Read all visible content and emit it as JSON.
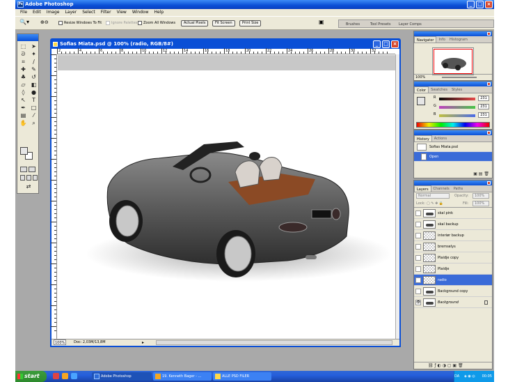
{
  "app": {
    "title": "Adobe Photoshop",
    "menu": [
      "File",
      "Edit",
      "Image",
      "Layer",
      "Select",
      "Filter",
      "View",
      "Window",
      "Help"
    ]
  },
  "options": {
    "resize_windows": "Resize Windows To Fit",
    "ignore_palettes": "Ignore Palettes",
    "zoom_all": "Zoom All Windows",
    "actual_pixels": "Actual Pixels",
    "fit_screen": "Fit Screen",
    "print_size": "Print Size",
    "well_tabs": [
      "Brushes",
      "Tool Presets",
      "Layer Comps"
    ]
  },
  "document": {
    "title": "Sofias Miata.psd @ 100% (radio, RGB/8#)",
    "zoom": "100%",
    "doc_size": "Doc: 2,03M/13,8M",
    "ruler_labels": [
      "2",
      "4",
      "6",
      "8",
      "10",
      "12",
      "14",
      "16",
      "18",
      "20",
      "22",
      "24",
      "26",
      "28",
      "30",
      "32"
    ]
  },
  "navigator": {
    "tabs": [
      "Navigator",
      "Info",
      "Histogram"
    ],
    "zoom": "100%"
  },
  "color": {
    "tabs": [
      "Color",
      "Swatches",
      "Styles"
    ],
    "rows": [
      {
        "label": "R",
        "value": "231",
        "color": "#e84a4a"
      },
      {
        "label": "G",
        "value": "231",
        "color": "#45c645"
      },
      {
        "label": "B",
        "value": "231",
        "color": "#4a6ae8"
      }
    ]
  },
  "history": {
    "tabs": [
      "History",
      "Actions"
    ],
    "items": [
      {
        "label": "Sofias Miata.psd",
        "selected": false
      },
      {
        "label": "Open",
        "selected": true
      }
    ]
  },
  "layers": {
    "tabs": [
      "Layers",
      "Channels",
      "Paths"
    ],
    "blend_mode": "Normal",
    "opacity_label": "Opacity:",
    "opacity": "100%",
    "lock_label": "Lock:",
    "fill_label": "Fill:",
    "fill": "100%",
    "items": [
      {
        "name": "skal pink",
        "visible": false,
        "selected": false,
        "thumb": "car"
      },
      {
        "name": "skal backup",
        "visible": false,
        "selected": false,
        "thumb": "car"
      },
      {
        "name": "interiør backup",
        "visible": false,
        "selected": false,
        "thumb": "trans"
      },
      {
        "name": "bremselys",
        "visible": false,
        "selected": false,
        "thumb": "trans"
      },
      {
        "name": "Plaidje copy",
        "visible": false,
        "selected": false,
        "thumb": "trans"
      },
      {
        "name": "Plaidje",
        "visible": false,
        "selected": false,
        "thumb": "trans"
      },
      {
        "name": "radio",
        "visible": false,
        "selected": true,
        "thumb": "trans"
      },
      {
        "name": "Background copy",
        "visible": false,
        "selected": false,
        "thumb": "car"
      },
      {
        "name": "Background",
        "visible": true,
        "selected": false,
        "thumb": "car",
        "locked": true
      }
    ]
  },
  "taskbar": {
    "start": "start",
    "tasks": [
      {
        "label": "Adobe Photoshop",
        "active": true
      },
      {
        "label": "19. Kenneth Bager - ...",
        "active": false
      },
      {
        "label": "ALLE PSD FILER",
        "active": false
      }
    ],
    "lang": "DA",
    "clock": "00:05"
  }
}
